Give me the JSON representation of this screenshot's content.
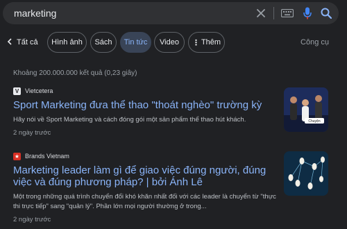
{
  "search": {
    "query": "marketing"
  },
  "filters": {
    "back_label": "Tất cả",
    "chips": [
      {
        "label": "Hình ảnh"
      },
      {
        "label": "Sách"
      },
      {
        "label": "Tin tức"
      },
      {
        "label": "Video"
      },
      {
        "label": "Thêm"
      }
    ],
    "tools_label": "Công cụ"
  },
  "stats": "Khoảng 200.000.000 kết quả (0,23 giây)",
  "results": [
    {
      "source": "Vietcetera",
      "title": "Sport Marketing đưa thể thao \"thoát nghèo\" trường kỳ",
      "snippet": "Hãy nói về Sport Marketing và cách đóng gói một sản phẩm thể thao hút khách.",
      "date": "2 ngày trước",
      "thumb_caption": "Chuyện"
    },
    {
      "source": "Brands Vietnam",
      "title": "Marketing leader làm gì để giao việc đúng người, đúng việc và đúng phương pháp? | bởi Ánh Lê",
      "snippet": "Một trong những quá trình chuyển đổi khó khăn nhất đối với các leader là chuyển từ \"thực thi trực tiếp\" sang \"quản lý\". Phần lớn mọi người thường ở trong...",
      "date": "2 ngày trước"
    }
  ],
  "colors": {
    "background": "#202124",
    "link": "#8ab4f8",
    "active_chip_bg": "#394457"
  }
}
